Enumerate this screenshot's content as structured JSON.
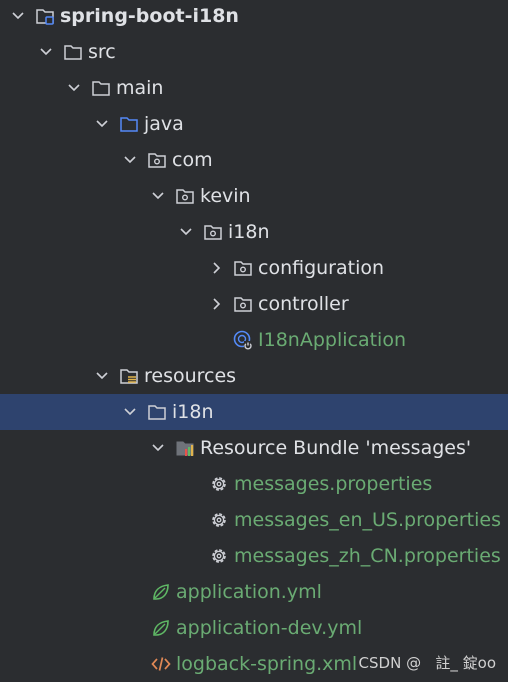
{
  "tree": {
    "project": "spring-boot-i18n",
    "src": "src",
    "main": "main",
    "java": "java",
    "com": "com",
    "kevin": "kevin",
    "i18n_pkg": "i18n",
    "configuration": "configuration",
    "controller": "controller",
    "app_class": "I18nApplication",
    "resources": "resources",
    "i18n_dir": "i18n",
    "bundle": "Resource Bundle 'messages'",
    "messages": "messages.properties",
    "messages_en": "messages_en_US.properties",
    "messages_zh": "messages_zh_CN.properties",
    "application_yml": "application.yml",
    "application_dev_yml": "application-dev.yml",
    "logback": "logback-spring.xml"
  },
  "watermark": "CSDN @   註_ 錠oo",
  "colors": {
    "background": "#2b2d30",
    "selection": "#2e436e",
    "text": "#dfe1e5",
    "green_text": "#6aab73",
    "source_folder": "#548af7",
    "spring": "#5fb865",
    "xml": "#e08855"
  }
}
